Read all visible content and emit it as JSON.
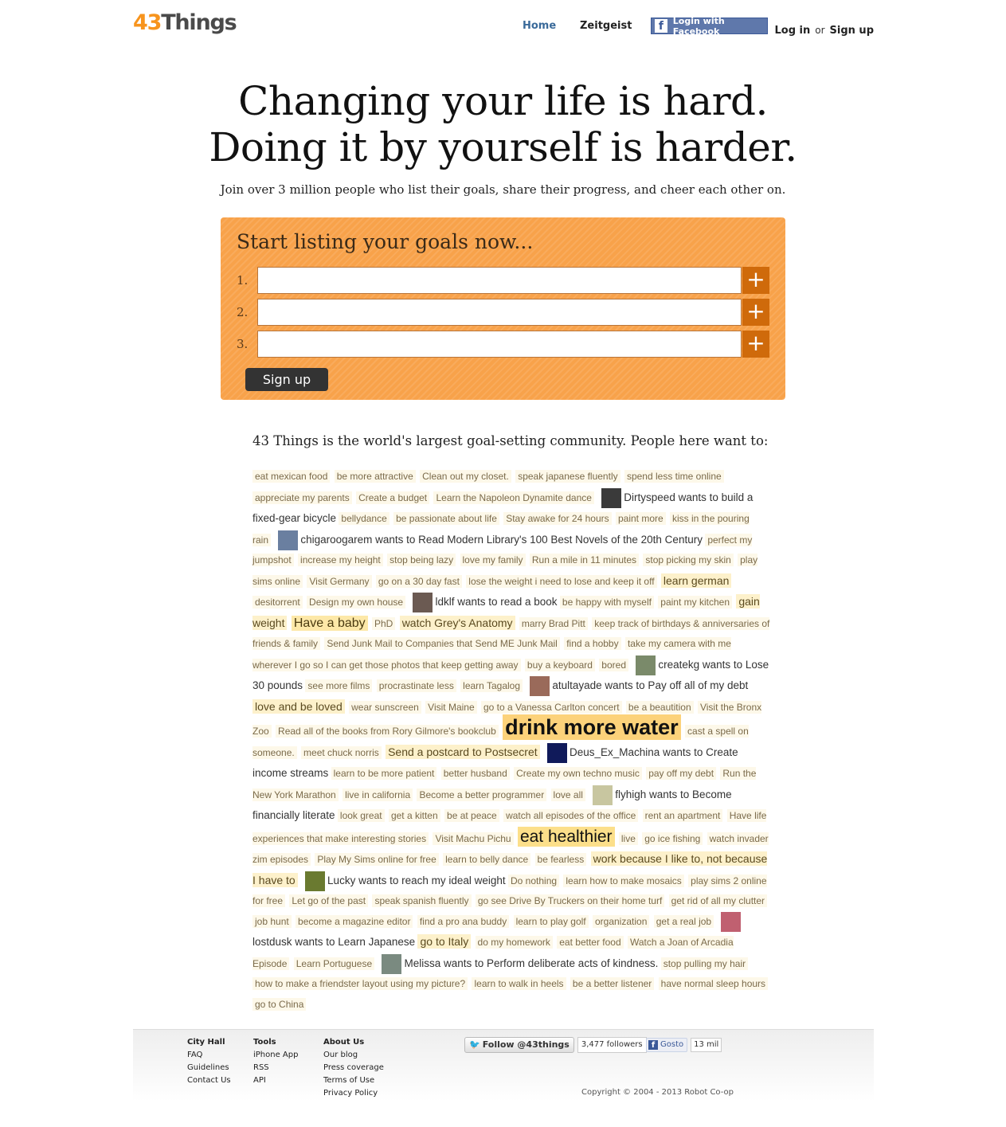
{
  "header": {
    "logo_num": "43",
    "logo_word": "Things",
    "nav_home": "Home",
    "nav_zeitgeist": "Zeitgeist",
    "facebook_login": "Login with Facebook",
    "login": "Log in",
    "or": "or",
    "signup": "Sign up"
  },
  "hero": {
    "line1": "Changing your life is hard.",
    "line2": "Doing it by yourself is harder.",
    "subtitle": "Join over 3 million people who list their goals, share their progress, and cheer each other on."
  },
  "goal_box": {
    "title": "Start listing your goals now...",
    "rows": [
      {
        "num": "1.",
        "value": "",
        "add": "+"
      },
      {
        "num": "2.",
        "value": "",
        "add": "+"
      },
      {
        "num": "3.",
        "value": "",
        "add": "+"
      }
    ],
    "signup_button": "Sign up"
  },
  "community": {
    "heading": "43 Things is the world's largest goal-setting community. People here want to:",
    "items": [
      {
        "t": "eat mexican food",
        "s": 1
      },
      {
        "t": "be more attractive",
        "s": 1
      },
      {
        "t": "Clean out my closet.",
        "s": 1
      },
      {
        "t": "speak japanese fluently",
        "s": 1
      },
      {
        "t": "spend less time online",
        "s": 1
      },
      {
        "t": "appreciate my parents",
        "s": 1
      },
      {
        "t": "Create a budget",
        "s": 1
      },
      {
        "t": "Learn the Napoleon Dynamite dance",
        "s": 1
      },
      {
        "p": "Dirtyspeed wants to build a fixed-gear bicycle",
        "c": "#3a3a3a"
      },
      {
        "t": "bellydance",
        "s": 1
      },
      {
        "t": "be passionate about life",
        "s": 1
      },
      {
        "t": "Stay awake for 24 hours",
        "s": 1
      },
      {
        "t": "paint more",
        "s": 1
      },
      {
        "t": "kiss in the pouring rain",
        "s": 1
      },
      {
        "p": "chigaroogarem wants to Read Modern Library's 100 Best Novels of the 20th Century",
        "c": "#6a7fa0"
      },
      {
        "t": "perfect my jumpshot",
        "s": 1
      },
      {
        "t": "increase my height",
        "s": 1
      },
      {
        "t": "stop being lazy",
        "s": 1
      },
      {
        "t": "love my family",
        "s": 1
      },
      {
        "t": "Run a mile in 11 minutes",
        "s": 1
      },
      {
        "t": "stop picking my skin",
        "s": 1
      },
      {
        "t": "play sims online",
        "s": 1
      },
      {
        "t": "Visit Germany",
        "s": 1
      },
      {
        "t": "go on a 30 day fast",
        "s": 1
      },
      {
        "t": "lose the weight i need to lose and keep it off",
        "s": 1
      },
      {
        "t": "learn german",
        "s": 2
      },
      {
        "t": "desitorrent",
        "s": 1
      },
      {
        "t": "Design my own house",
        "s": 1
      },
      {
        "p": "ldklf wants to read a book",
        "c": "#6b5a52"
      },
      {
        "t": "be happy with myself",
        "s": 1
      },
      {
        "t": "paint my kitchen",
        "s": 1
      },
      {
        "t": "gain weight",
        "s": 2
      },
      {
        "t": "Have a baby",
        "s": 3
      },
      {
        "t": "PhD",
        "s": 1
      },
      {
        "t": "watch Grey's Anatomy",
        "s": 2
      },
      {
        "t": "marry Brad Pitt",
        "s": 1
      },
      {
        "t": "keep track of birthdays & anniversaries of friends & family",
        "s": 1
      },
      {
        "t": "Send Junk Mail to Companies that Send ME Junk Mail",
        "s": 1
      },
      {
        "t": "find a hobby",
        "s": 1
      },
      {
        "t": "take my camera with me wherever I go so I can get those photos that keep getting away",
        "s": 1
      },
      {
        "t": "buy a keyboard",
        "s": 1
      },
      {
        "t": "bored",
        "s": 1
      },
      {
        "p": "createkg wants to Lose 30 pounds",
        "c": "#7a8a6a"
      },
      {
        "t": "see more films",
        "s": 1
      },
      {
        "t": "procrastinate less",
        "s": 1
      },
      {
        "t": "learn Tagalog",
        "s": 1
      },
      {
        "p": "atultayade wants to Pay off all of my debt",
        "c": "#9a6a5a"
      },
      {
        "t": "love and be loved",
        "s": 2
      },
      {
        "t": "wear sunscreen",
        "s": 1
      },
      {
        "t": "Visit Maine",
        "s": 1
      },
      {
        "t": "go to a Vanessa Carlton concert",
        "s": 1
      },
      {
        "t": "be a beautition",
        "s": 1
      },
      {
        "t": "Visit the Bronx Zoo",
        "s": 1
      },
      {
        "t": "Read all of the books from Rory Gilmore's bookclub",
        "s": 1
      },
      {
        "t": "drink more water",
        "s": 5
      },
      {
        "t": "cast a spell on someone.",
        "s": 1
      },
      {
        "t": "meet chuck norris",
        "s": 1
      },
      {
        "t": "Send a postcard to Postsecret",
        "s": 2
      },
      {
        "p": "Deus_Ex_Machina wants to Create income streams",
        "c": "#101a5a"
      },
      {
        "t": "learn to be more patient",
        "s": 1
      },
      {
        "t": "better husband",
        "s": 1
      },
      {
        "t": "Create my own techno music",
        "s": 1
      },
      {
        "t": "pay off my debt",
        "s": 1
      },
      {
        "t": "Run the New York Marathon",
        "s": 1
      },
      {
        "t": "live in california",
        "s": 1
      },
      {
        "t": "Become a better programmer",
        "s": 1
      },
      {
        "t": "love all",
        "s": 1
      },
      {
        "p": "flyhigh wants to Become financially literate",
        "c": "#c8c6a0"
      },
      {
        "t": "look great",
        "s": 1
      },
      {
        "t": "get a kitten",
        "s": 1
      },
      {
        "t": "be at peace",
        "s": 1
      },
      {
        "t": "watch all episodes of the office",
        "s": 1
      },
      {
        "t": "rent an apartment",
        "s": 1
      },
      {
        "t": "Have life experiences that make interesting stories",
        "s": 1
      },
      {
        "t": "Visit Machu Pichu",
        "s": 1
      },
      {
        "t": "eat healthier",
        "s": 4
      },
      {
        "t": "live",
        "s": 1
      },
      {
        "t": "go ice fishing",
        "s": 1
      },
      {
        "t": "watch invader zim episodes",
        "s": 1
      },
      {
        "t": "Play My Sims online for free",
        "s": 1
      },
      {
        "t": "learn to belly dance",
        "s": 1
      },
      {
        "t": "be fearless",
        "s": 1
      },
      {
        "t": "work because I like to, not because I have to",
        "s": 2
      },
      {
        "p": "Lucky wants to reach my ideal weight",
        "c": "#6a7a30"
      },
      {
        "t": "Do nothing",
        "s": 1
      },
      {
        "t": "learn how to make mosaics",
        "s": 1
      },
      {
        "t": "play sims 2 online for free",
        "s": 1
      },
      {
        "t": "Let go of the past",
        "s": 1
      },
      {
        "t": "speak spanish fluently",
        "s": 1
      },
      {
        "t": "go see Drive By Truckers on their home turf",
        "s": 1
      },
      {
        "t": "get rid of all my clutter",
        "s": 1
      },
      {
        "t": "job hunt",
        "s": 1
      },
      {
        "t": "become a magazine editor",
        "s": 1
      },
      {
        "t": "find a pro ana buddy",
        "s": 1
      },
      {
        "t": "learn to play golf",
        "s": 1
      },
      {
        "t": "organization",
        "s": 1
      },
      {
        "t": "get a real job",
        "s": 1
      },
      {
        "p": "lostdusk wants to Learn Japanese",
        "c": "#c06070"
      },
      {
        "t": "go to Italy",
        "s": 2
      },
      {
        "t": "do my homework",
        "s": 1
      },
      {
        "t": "eat better food",
        "s": 1
      },
      {
        "t": "Watch a Joan of Arcadia Episode",
        "s": 1
      },
      {
        "t": "Learn Portuguese",
        "s": 1
      },
      {
        "p": "Melissa wants to Perform deliberate acts of kindness.",
        "c": "#7a8a80"
      },
      {
        "t": "stop pulling my hair",
        "s": 1
      },
      {
        "t": "how to make a friendster layout using my picture?",
        "s": 1
      },
      {
        "t": "learn to walk in heels",
        "s": 1
      },
      {
        "t": "be a better listener",
        "s": 1
      },
      {
        "t": "have normal sleep hours",
        "s": 1
      },
      {
        "t": "go to China",
        "s": 1
      }
    ]
  },
  "footer": {
    "col1": {
      "heading": "City Hall",
      "links": [
        "FAQ",
        "Guidelines",
        "Contact Us"
      ]
    },
    "col2": {
      "heading": "Tools",
      "links": [
        "iPhone App",
        "RSS",
        "API"
      ]
    },
    "col3": {
      "heading": "About Us",
      "links": [
        "Our blog",
        "Press coverage",
        "Terms of Use",
        "Privacy Policy"
      ]
    },
    "twitter_follow": "Follow @43things",
    "twitter_followers": "3,477 followers",
    "facebook_like": "Gosto",
    "facebook_count": "13 mil",
    "copyright": "Copyright © 2004 - 2013 Robot Co-op"
  }
}
